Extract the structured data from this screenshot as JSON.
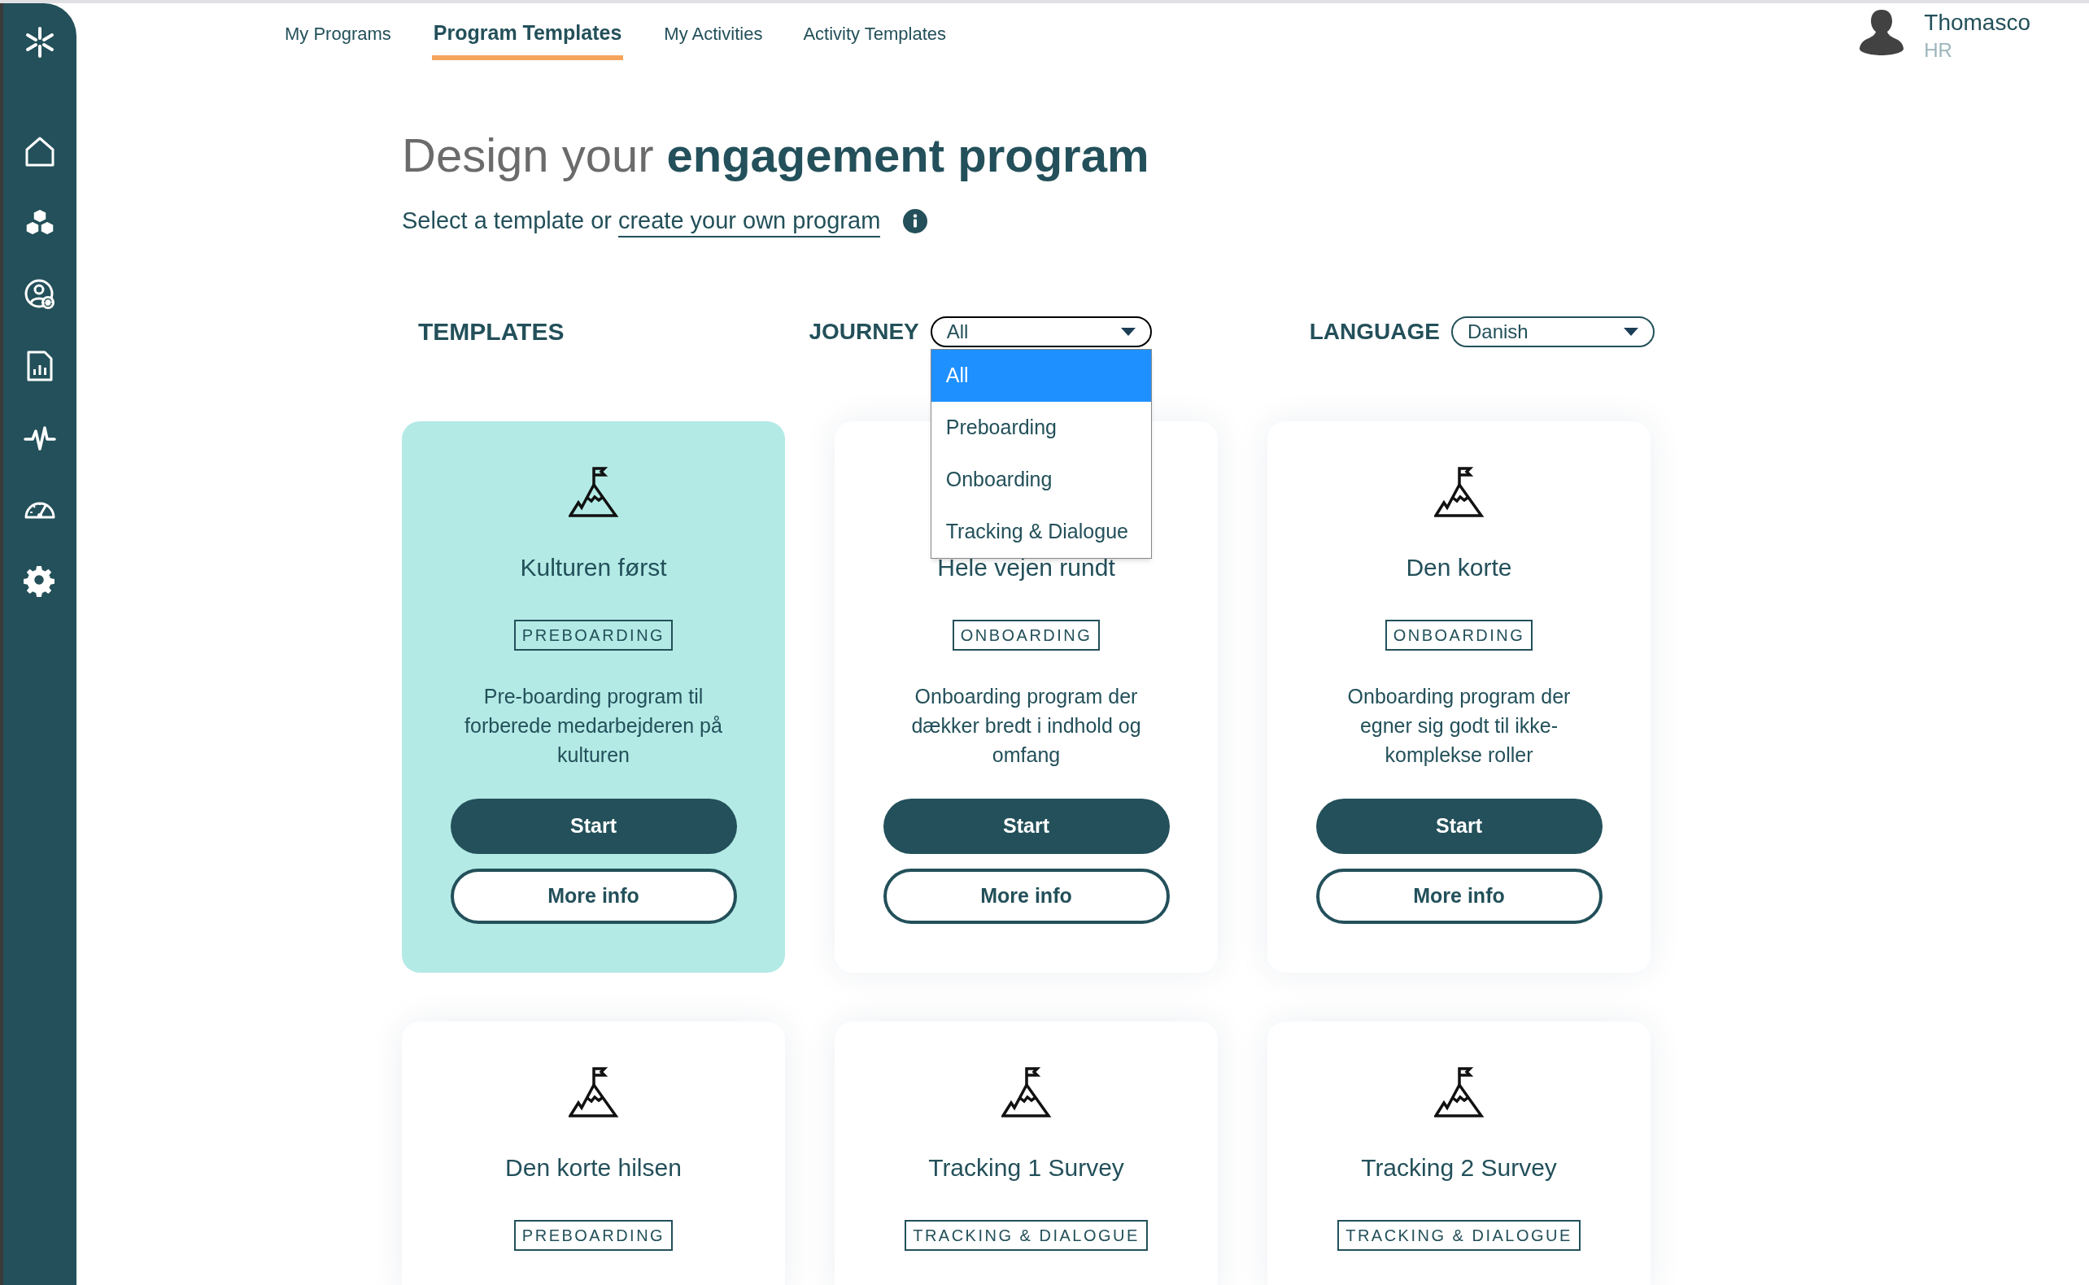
{
  "sidebar": {
    "items": [
      {
        "kind": "logo"
      },
      {
        "kind": "home"
      },
      {
        "kind": "cubes"
      },
      {
        "kind": "user-sync"
      },
      {
        "kind": "report"
      },
      {
        "kind": "pulse"
      },
      {
        "kind": "gauge"
      },
      {
        "kind": "gear"
      }
    ]
  },
  "nav": {
    "tabs": [
      {
        "label": "My Programs",
        "selected": false
      },
      {
        "label": "Program Templates",
        "selected": true
      },
      {
        "label": "My Activities",
        "selected": false
      },
      {
        "label": "Activity Templates",
        "selected": false
      }
    ]
  },
  "user": {
    "name": "Thomasco",
    "role": "HR"
  },
  "heading": {
    "light": "Design your",
    "bold": "engagement program"
  },
  "subtitle": {
    "text": "Select a template or",
    "link": "create your own program"
  },
  "filters": {
    "title": "TEMPLATES",
    "journey": {
      "label": "JOURNEY",
      "value": "All",
      "open": true,
      "options": [
        {
          "label": "All",
          "selected": true
        },
        {
          "label": "Preboarding",
          "selected": false
        },
        {
          "label": "Onboarding",
          "selected": false
        },
        {
          "label": "Tracking & Dialogue",
          "selected": false
        }
      ]
    },
    "language": {
      "label": "LANGUAGE",
      "value": "Danish",
      "open": false
    }
  },
  "cards": [
    {
      "title": "Kulturen først",
      "tag": "PREBOARDING",
      "description": "Pre-boarding program til forberede medarbejderen på kulturen",
      "buttons": [
        "Start",
        "More info"
      ],
      "selected": true
    },
    {
      "title": "Hele vejen rundt",
      "tag": "ONBOARDING",
      "description": "Onboarding program der dækker bredt i indhold og omfang",
      "buttons": [
        "Start",
        "More info"
      ],
      "selected": false
    },
    {
      "title": "Den korte",
      "tag": "ONBOARDING",
      "description": "Onboarding program der egner sig godt til ikke-komplekse roller",
      "buttons": [
        "Start",
        "More info"
      ],
      "selected": false
    },
    {
      "title": "Den korte hilsen",
      "tag": "PREBOARDING",
      "selected": false
    },
    {
      "title": "Tracking 1 Survey",
      "tag": "TRACKING & DIALOGUE",
      "selected": false
    },
    {
      "title": "Tracking 2 Survey",
      "tag": "TRACKING & DIALOGUE",
      "selected": false
    }
  ]
}
